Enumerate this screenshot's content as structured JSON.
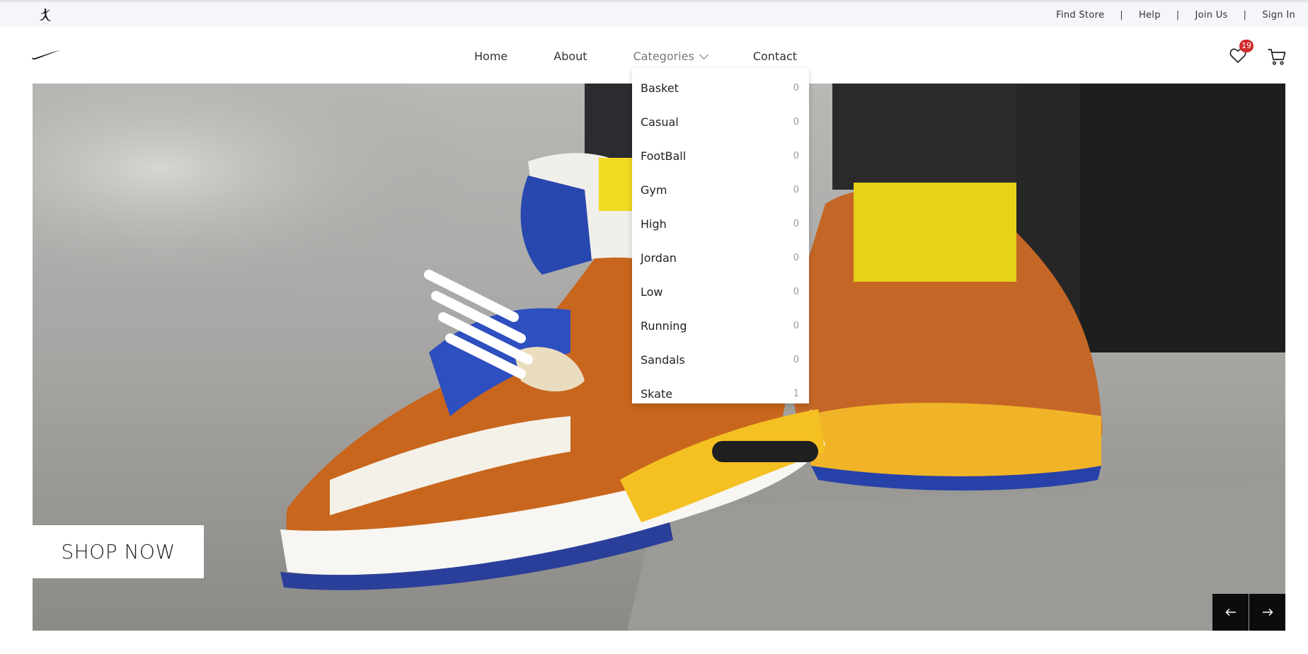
{
  "topbar": {
    "logo_icon": "jordan-jumpman-icon",
    "links": [
      "Find Store",
      "Help",
      "Join Us",
      "Sign In"
    ],
    "separator": "|"
  },
  "nav": {
    "logo_icon": "nike-swoosh-icon",
    "menu": {
      "home": "Home",
      "about": "About",
      "categories": "Categories",
      "contact": "Contact"
    },
    "wishlist": {
      "icon": "heart-icon",
      "count": "19"
    },
    "cart": {
      "icon": "cart-icon"
    }
  },
  "categories_dropdown": [
    {
      "label": "Basket",
      "count": "0"
    },
    {
      "label": "Casual",
      "count": "0"
    },
    {
      "label": "FootBall",
      "count": "0"
    },
    {
      "label": "Gym",
      "count": "0"
    },
    {
      "label": "High",
      "count": "0"
    },
    {
      "label": "Jordan",
      "count": "0"
    },
    {
      "label": "Low",
      "count": "0"
    },
    {
      "label": "Running",
      "count": "0"
    },
    {
      "label": "Sandals",
      "count": "0"
    },
    {
      "label": "Skate",
      "count": "1"
    }
  ],
  "hero": {
    "image_subject": "orange and yellow sneakers on pavement",
    "cta_label": "SHOP NOW",
    "prev_icon": "arrow-left-icon",
    "next_icon": "arrow-right-icon"
  },
  "colors": {
    "badge": "#d12b2b",
    "topbar_bg": "#f5f6fa",
    "slider_button_bg": "#0c0c0c"
  }
}
